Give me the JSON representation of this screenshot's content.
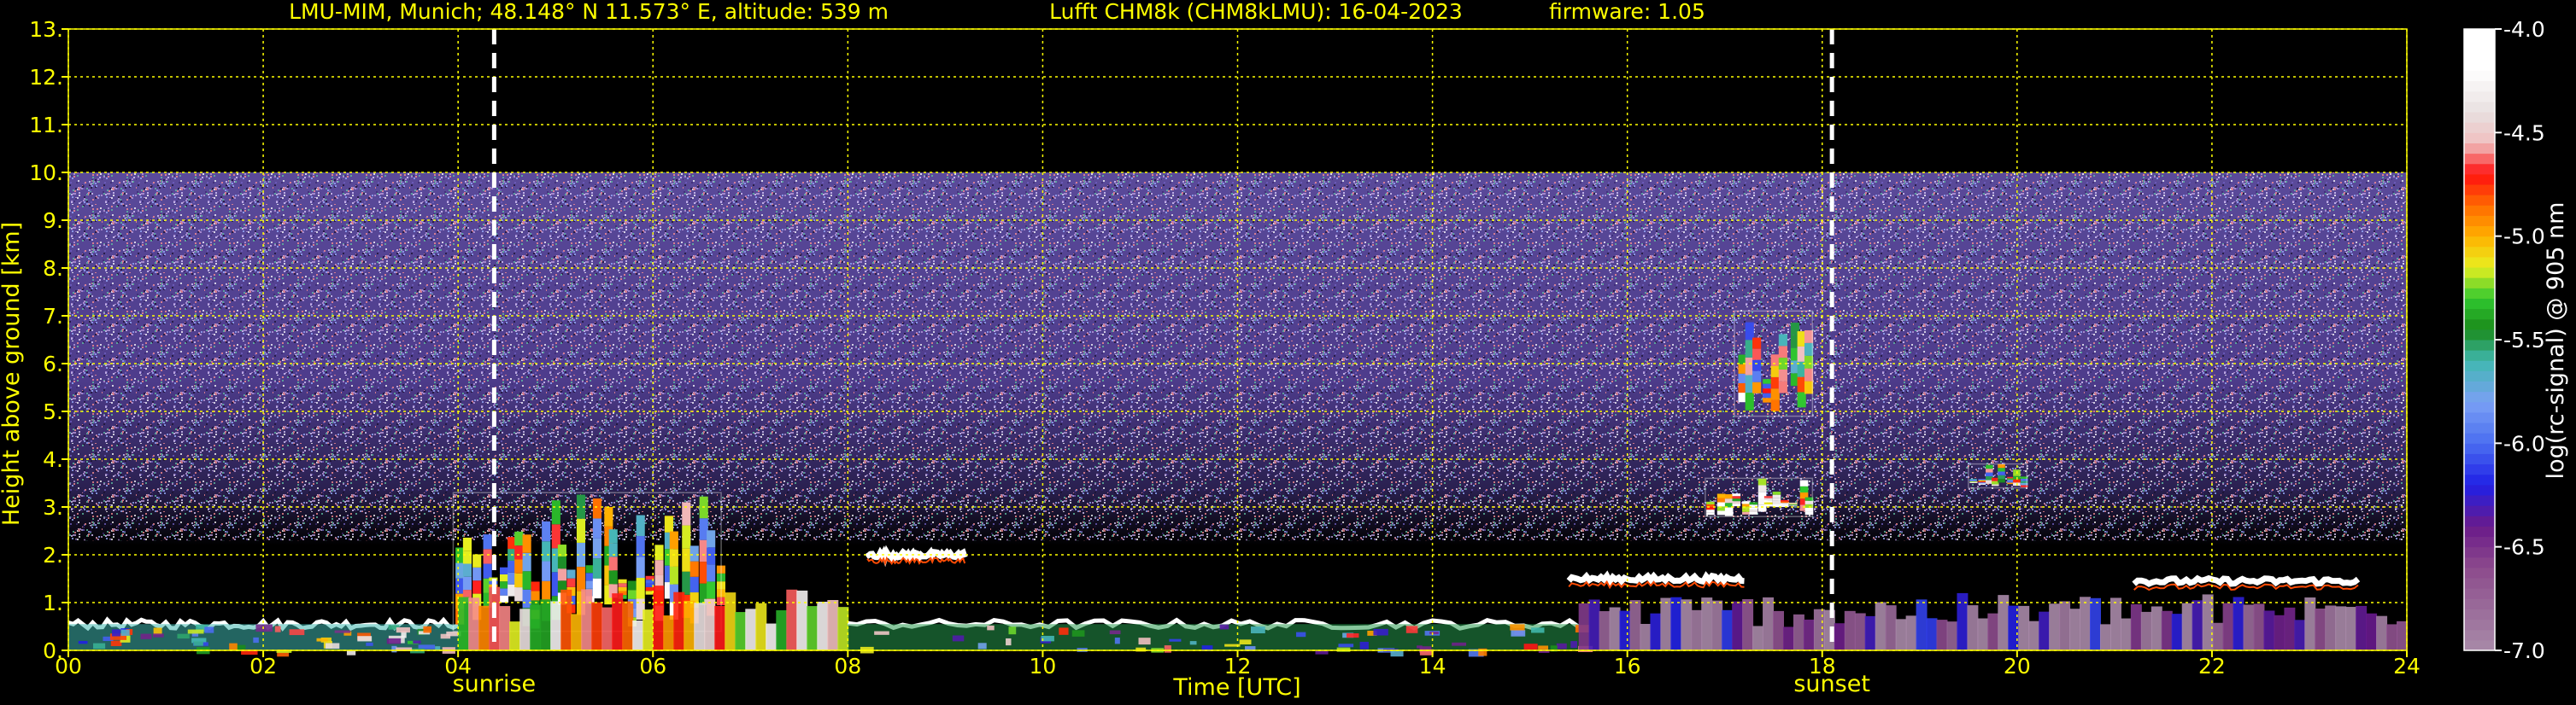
{
  "header": {
    "station": "LMU-MIM, Munich; 48.148° N 11.573° E, altitude: 539 m",
    "instrument": "Lufft CHM8k (CHM8kLMU): 16-04-2023",
    "firmware": "firmware: 1.05"
  },
  "colors": {
    "background": "#000000",
    "text": "#ffff00",
    "grid": "#ffff00",
    "event_lines": "#ffffff",
    "colorbar_label": "#ffffff"
  },
  "chart_data": {
    "type": "heatmap",
    "xlabel": "Time [UTC]",
    "ylabel": "Height above ground [km]",
    "xlim": [
      0,
      24
    ],
    "ylim": [
      0,
      13
    ],
    "x_ticks": [
      "00",
      "02",
      "04",
      "06",
      "08",
      "10",
      "12",
      "14",
      "16",
      "18",
      "20",
      "22",
      "24"
    ],
    "y_ticks": [
      "0.",
      "1.",
      "2.",
      "3.",
      "4.",
      "5.",
      "6.",
      "7.",
      "8.",
      "9.",
      "10.",
      "11.",
      "12.",
      "13."
    ],
    "x_tick_values": [
      0,
      2,
      4,
      6,
      8,
      10,
      12,
      14,
      16,
      18,
      20,
      22,
      24
    ],
    "y_tick_values": [
      0,
      1,
      2,
      3,
      4,
      5,
      6,
      7,
      8,
      9,
      10,
      11,
      12,
      13
    ],
    "grid": true,
    "grid_style": "dotted",
    "data_ceiling_km": 10,
    "events": [
      {
        "label": "sunrise",
        "time": 4.37
      },
      {
        "label": "sunset",
        "time": 18.1
      }
    ],
    "colorbar": {
      "label": "log(rc-signal) @ 905 nm",
      "range": [
        -7.0,
        -4.0
      ],
      "ticks": [
        "-4.0",
        "-4.5",
        "-5.0",
        "-5.5",
        "-6.0",
        "-6.5",
        "-7.0"
      ],
      "tick_values": [
        -4.0,
        -4.5,
        -5.0,
        -5.5,
        -6.0,
        -6.5,
        -7.0
      ],
      "stops": [
        {
          "value": -7.0,
          "color": "#a88aa8"
        },
        {
          "value": -6.8,
          "color": "#9a6c9a"
        },
        {
          "value": -6.6,
          "color": "#8c4a8c"
        },
        {
          "value": -6.4,
          "color": "#6a1a8a"
        },
        {
          "value": -6.2,
          "color": "#2020e6"
        },
        {
          "value": -6.0,
          "color": "#4a6ef0"
        },
        {
          "value": -5.8,
          "color": "#7aa0f4"
        },
        {
          "value": -5.6,
          "color": "#40b8b0"
        },
        {
          "value": -5.45,
          "color": "#1a8a1a"
        },
        {
          "value": -5.3,
          "color": "#30c830"
        },
        {
          "value": -5.15,
          "color": "#e8f020"
        },
        {
          "value": -5.0,
          "color": "#ffb000"
        },
        {
          "value": -4.85,
          "color": "#ff6a00"
        },
        {
          "value": -4.7,
          "color": "#ff1010"
        },
        {
          "value": -4.55,
          "color": "#f0c0c0"
        },
        {
          "value": -4.4,
          "color": "#e8e0e0"
        },
        {
          "value": -4.2,
          "color": "#ffffff"
        },
        {
          "value": -4.0,
          "color": "#ffffff"
        }
      ]
    },
    "features": [
      {
        "kind": "boundary_layer",
        "t0": 0.0,
        "t1": 4.0,
        "h": 0.55,
        "log": -5.6
      },
      {
        "kind": "cloud",
        "t0": 3.95,
        "t1": 6.7,
        "h0": 0.4,
        "h1": 3.3,
        "log": -4.9
      },
      {
        "kind": "aerosol",
        "t0": 4.0,
        "t1": 8.0,
        "h0": 0.0,
        "h1": 1.4,
        "log": -4.8
      },
      {
        "kind": "cloud_layer",
        "t0": 8.2,
        "t1": 9.2,
        "h": 2.0,
        "log": -4.2
      },
      {
        "kind": "boundary_layer",
        "t0": 8.0,
        "t1": 15.5,
        "h": 0.55,
        "log": -5.5
      },
      {
        "kind": "cloud_layer",
        "t0": 15.4,
        "t1": 17.2,
        "h": 1.5,
        "log": -4.2
      },
      {
        "kind": "cloud",
        "t0": 16.8,
        "t1": 17.9,
        "h0": 2.8,
        "h1": 3.6,
        "log": -4.2
      },
      {
        "kind": "cloud",
        "t0": 17.1,
        "t1": 17.9,
        "h0": 4.9,
        "h1": 7.1,
        "log": -4.9
      },
      {
        "kind": "cloud",
        "t0": 19.5,
        "t1": 20.1,
        "h0": 3.4,
        "h1": 3.9,
        "log": -4.9
      },
      {
        "kind": "cloud_layer",
        "t0": 21.2,
        "t1": 23.5,
        "h": 1.45,
        "log": -4.2
      },
      {
        "kind": "aerosol",
        "t0": 15.5,
        "t1": 24.0,
        "h0": 0.0,
        "h1": 1.2,
        "log": -6.7
      }
    ]
  }
}
